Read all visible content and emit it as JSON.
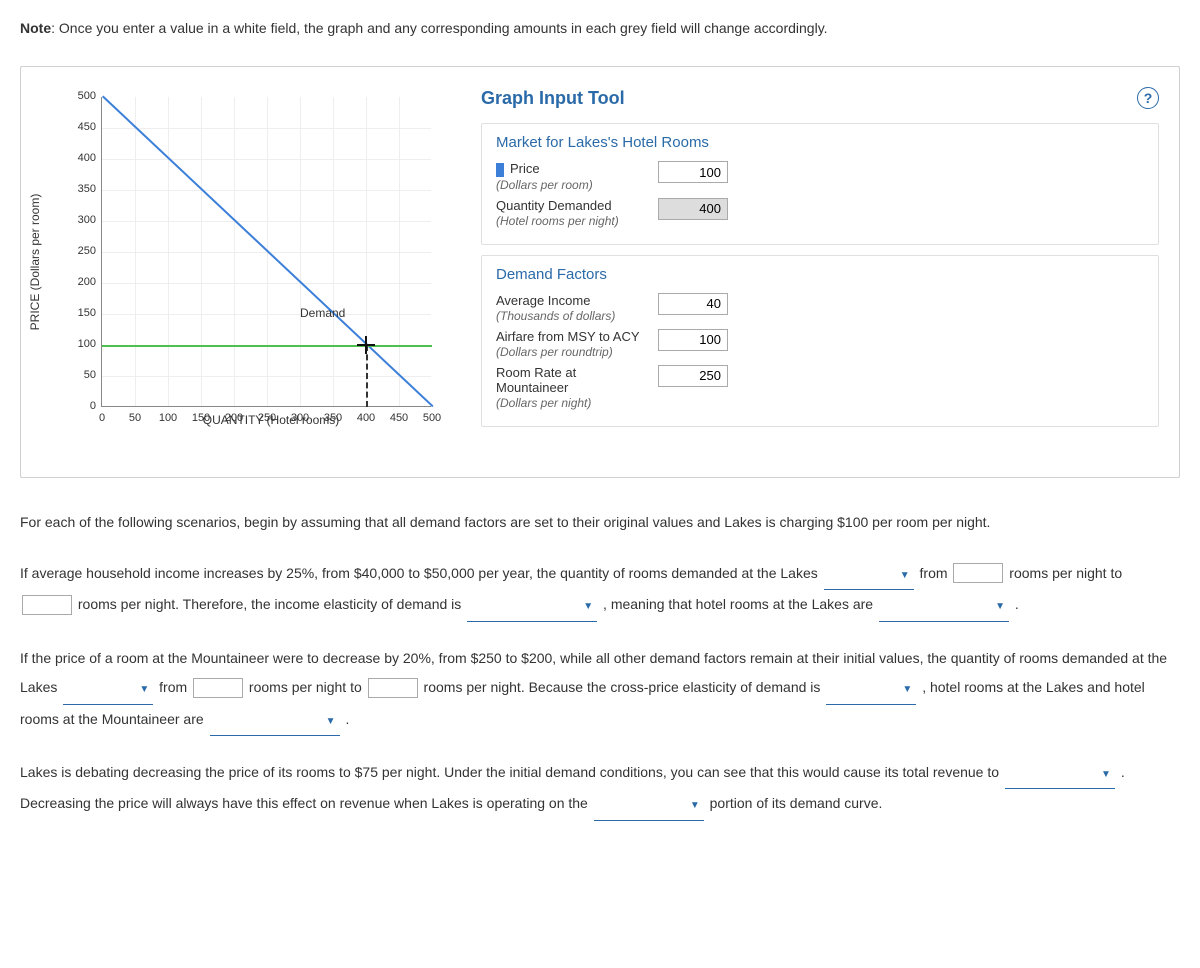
{
  "note": {
    "prefix": "Note",
    "text": ": Once you enter a value in a white field, the graph and any corresponding amounts in each grey field will change accordingly."
  },
  "chart_data": {
    "type": "line",
    "xlabel": "QUANTITY (Hotel rooms)",
    "ylabel": "PRICE (Dollars per room)",
    "xlim": [
      0,
      500
    ],
    "ylim": [
      0,
      500
    ],
    "xticks": [
      0,
      50,
      100,
      150,
      200,
      250,
      300,
      350,
      400,
      450,
      500
    ],
    "yticks": [
      0,
      50,
      100,
      150,
      200,
      250,
      300,
      350,
      400,
      450,
      500
    ],
    "series": [
      {
        "name": "Demand",
        "color": "#3b7fd9",
        "x": [
          0,
          500
        ],
        "y": [
          500,
          0
        ]
      },
      {
        "name": "PriceLine",
        "color": "#4fc04f",
        "x": [
          0,
          500
        ],
        "y": [
          100,
          100
        ]
      }
    ],
    "marker": {
      "x": 400,
      "y": 100
    },
    "annotation": {
      "text": "Demand",
      "x": 300,
      "y": 140
    }
  },
  "tool": {
    "title": "Graph Input Tool",
    "market_heading": "Market for Lakes's Hotel Rooms",
    "price_label": "Price",
    "price_sub": "(Dollars per room)",
    "price_value": "100",
    "quantity_label": "Quantity Demanded",
    "quantity_sub": "(Hotel rooms per night)",
    "quantity_value": "400",
    "demand_heading": "Demand Factors",
    "income_label": "Average Income",
    "income_sub": "(Thousands of dollars)",
    "income_value": "40",
    "airfare_label": "Airfare from MSY to ACY",
    "airfare_sub": "(Dollars per roundtrip)",
    "airfare_value": "100",
    "roomrate_label": "Room Rate at Mountaineer",
    "roomrate_sub": "(Dollars per night)",
    "roomrate_value": "250"
  },
  "q": {
    "intro": "For each of the following scenarios, begin by assuming that all demand factors are set to their original values and Lakes is charging $100 per room per night.",
    "p2a": "If average household income increases by 25%, from $40,000 to $50,000 per year, the quantity of rooms demanded at the Lakes ",
    "p2b": " from ",
    "p2c": " rooms per night to ",
    "p2d": " rooms per night. Therefore, the income elasticity of demand is ",
    "p2e": " , meaning that hotel rooms at the Lakes are ",
    "p2f": " .",
    "p3a": "If the price of a room at the Mountaineer were to decrease by 20%, from $250 to $200, while all other demand factors remain at their initial values, the quantity of rooms demanded at the Lakes ",
    "p3b": " from ",
    "p3c": " rooms per night to ",
    "p3d": " rooms per night. Because the cross-price elasticity of demand is ",
    "p3e": " , hotel rooms at the Lakes and hotel rooms at the Mountaineer are ",
    "p3f": " .",
    "p4a": "Lakes is debating decreasing the price of its rooms to $75 per night. Under the initial demand conditions, you can see that this would cause its total revenue to ",
    "p4b": " . Decreasing the price will always have this effect on revenue when Lakes is operating on the ",
    "p4c": " portion of its demand curve."
  }
}
